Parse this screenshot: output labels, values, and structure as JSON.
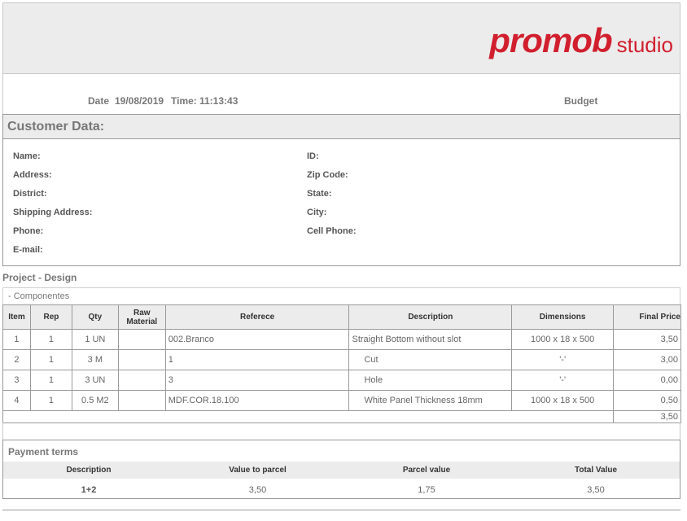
{
  "logo": {
    "word1": "promob",
    "word2": "studio"
  },
  "meta": {
    "date_label": "Date",
    "date": "19/08/2019",
    "time_label": "Time:",
    "time": "11:13:43",
    "doc_type": "Budget"
  },
  "customer": {
    "title": "Customer Data:",
    "left_fields": [
      "Name:",
      "Address:",
      "District:",
      "Shipping Address:",
      "Phone:",
      "E-mail:"
    ],
    "right_fields": [
      "ID:",
      "Zip Code:",
      "State:",
      "City:",
      "Cell Phone:"
    ]
  },
  "project": {
    "title": "Project - Design",
    "section": "- Componentes"
  },
  "components": {
    "headers": {
      "item": "Item",
      "rep": "Rep",
      "qty": "Qty",
      "raw1": "Raw",
      "raw2": "Material",
      "reference": "Referece",
      "description": "Description",
      "dimensions": "Dimensions",
      "final_price": "Final Price"
    },
    "rows": [
      {
        "item": "1",
        "rep": "1",
        "qty": "1 UN",
        "raw": "",
        "reference": "002.Branco",
        "description": "Straight Bottom without slot",
        "dimensions": "1000 x 18 x 500",
        "price": "3,50"
      },
      {
        "item": "2",
        "rep": "1",
        "qty": "3 M",
        "raw": "",
        "reference": "1",
        "description": "Cut",
        "dimensions": "'-'",
        "price": "3,00"
      },
      {
        "item": "3",
        "rep": "1",
        "qty": "3 UN",
        "raw": "",
        "reference": "3",
        "description": "Hole",
        "dimensions": "'-'",
        "price": "0,00"
      },
      {
        "item": "4",
        "rep": "1",
        "qty": "0.5 M2",
        "raw": "",
        "reference": "MDF.COR.18.100",
        "description": "White Panel Thickness 18mm",
        "dimensions": "1000 x 18 x 500",
        "price": "0,50"
      }
    ],
    "total": "3,50"
  },
  "payment": {
    "title": "Payment terms",
    "headers": {
      "description": "Description",
      "value_to_parcel": "Value to parcel",
      "parcel_value": "Parcel value",
      "total_value": "Total Value"
    },
    "row": {
      "description": "1+2",
      "value_to_parcel": "3,50",
      "parcel_value": "1,75",
      "total_value": "3,50"
    }
  }
}
